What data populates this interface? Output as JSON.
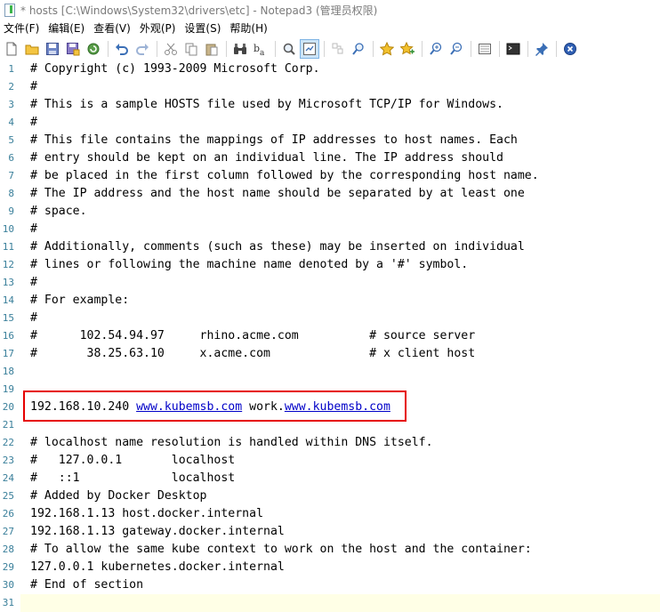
{
  "window": {
    "title": "* hosts [C:\\Windows\\System32\\drivers\\etc] - Notepad3  (管理员权限)"
  },
  "menu": [
    "文件(F)",
    "编辑(E)",
    "查看(V)",
    "外观(P)",
    "设置(S)",
    "帮助(H)"
  ],
  "toolbar": {
    "icons": [
      "new-file-icon",
      "open-folder-icon",
      "save-icon",
      "save-as-icon",
      "reload-icon",
      "undo-icon",
      "redo-icon",
      "cut-icon",
      "copy-icon",
      "paste-icon",
      "find-icon",
      "replace-icon",
      "word-wrap-icon",
      "zoom-find-icon",
      "toggle-view-icon",
      "find-in-files-icon",
      "favorites-icon",
      "add-favorite-icon",
      "zoom-in-icon",
      "zoom-out-icon",
      "page-setup-icon",
      "terminal-icon",
      "pin-icon",
      "close-icon"
    ]
  },
  "editor": {
    "lines": [
      {
        "n": "1",
        "parts": [
          {
            "t": "# Copyright (c) 1993-2009 Microsoft Corp."
          }
        ]
      },
      {
        "n": "2",
        "parts": [
          {
            "t": "#"
          }
        ]
      },
      {
        "n": "3",
        "parts": [
          {
            "t": "# This is a sample HOSTS file used by Microsoft TCP/IP for Windows."
          }
        ]
      },
      {
        "n": "4",
        "parts": [
          {
            "t": "#"
          }
        ]
      },
      {
        "n": "5",
        "parts": [
          {
            "t": "# This file contains the mappings of IP addresses to host names. Each"
          }
        ]
      },
      {
        "n": "6",
        "parts": [
          {
            "t": "# entry should be kept on an individual line. The IP address should"
          }
        ]
      },
      {
        "n": "7",
        "parts": [
          {
            "t": "# be placed in the first column followed by the corresponding host name."
          }
        ]
      },
      {
        "n": "8",
        "parts": [
          {
            "t": "# The IP address and the host name should be separated by at least one"
          }
        ]
      },
      {
        "n": "9",
        "parts": [
          {
            "t": "# space."
          }
        ]
      },
      {
        "n": "10",
        "parts": [
          {
            "t": "#"
          }
        ]
      },
      {
        "n": "11",
        "parts": [
          {
            "t": "# Additionally, comments (such as these) may be inserted on individual"
          }
        ]
      },
      {
        "n": "12",
        "parts": [
          {
            "t": "# lines or following the machine name denoted by a '#' symbol."
          }
        ]
      },
      {
        "n": "13",
        "parts": [
          {
            "t": "#"
          }
        ]
      },
      {
        "n": "14",
        "parts": [
          {
            "t": "# For example:"
          }
        ]
      },
      {
        "n": "15",
        "parts": [
          {
            "t": "#"
          }
        ]
      },
      {
        "n": "16",
        "parts": [
          {
            "t": "#      102.54.94.97     rhino.acme.com          # source server"
          }
        ]
      },
      {
        "n": "17",
        "parts": [
          {
            "t": "#       38.25.63.10     x.acme.com              # x client host"
          }
        ]
      },
      {
        "n": "18",
        "parts": [
          {
            "t": ""
          }
        ]
      },
      {
        "n": "19",
        "parts": [
          {
            "t": ""
          }
        ]
      },
      {
        "n": "20",
        "parts": [
          {
            "t": "192.168.10.240 "
          },
          {
            "t": "www.kubemsb.com",
            "link": true
          },
          {
            "t": " work."
          },
          {
            "t": "www.kubemsb.com",
            "link": true
          }
        ]
      },
      {
        "n": "21",
        "parts": [
          {
            "t": ""
          }
        ]
      },
      {
        "n": "22",
        "parts": [
          {
            "t": "# localhost name resolution is handled within DNS itself."
          }
        ]
      },
      {
        "n": "23",
        "parts": [
          {
            "t": "#   127.0.0.1       localhost"
          }
        ]
      },
      {
        "n": "24",
        "parts": [
          {
            "t": "#   ::1             localhost"
          }
        ]
      },
      {
        "n": "25",
        "parts": [
          {
            "t": "# Added by Docker Desktop"
          }
        ]
      },
      {
        "n": "26",
        "parts": [
          {
            "t": "192.168.1.13 host.docker.internal"
          }
        ]
      },
      {
        "n": "27",
        "parts": [
          {
            "t": "192.168.1.13 gateway.docker.internal"
          }
        ]
      },
      {
        "n": "28",
        "parts": [
          {
            "t": "# To allow the same kube context to work on the host and the container:"
          }
        ]
      },
      {
        "n": "29",
        "parts": [
          {
            "t": "127.0.0.1 kubernetes.docker.internal"
          }
        ]
      },
      {
        "n": "30",
        "parts": [
          {
            "t": "# End of section"
          }
        ]
      },
      {
        "n": "31",
        "parts": [
          {
            "t": ""
          }
        ]
      }
    ],
    "current_line": "31",
    "highlighted_line": "20"
  },
  "colors": {
    "line_number": "#3a7f9a",
    "link": "#0000c8",
    "highlight_border": "#e60000",
    "current_line_bg": "#ffffe6"
  }
}
